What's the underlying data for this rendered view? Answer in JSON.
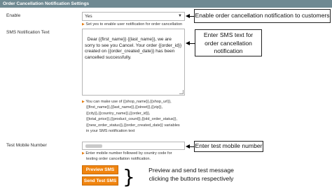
{
  "section": {
    "title": "Order Cancellation Notification Settings"
  },
  "enable": {
    "label": "Enable",
    "value": "Yes",
    "hint": "Set yes to enable user notification for order cancellation"
  },
  "sms_text": {
    "label": "SMS Notification Text",
    "value": "Dear {{first_name}} {{last_name}}, we are sorry to see you Cancel. Your order {{order_id}} created on {{order_created_date}} has been cancelled successfully.",
    "hint_lines": [
      "You can make use of {{shop_name}},{{shop_url}},",
      "{{first_name}},{{last_name}},{{street}},{{zip}},",
      "{{city}},{{country_name}},{{order_id}},",
      "{{total_price}},{{product_count}},{{old_order_status}},",
      "{{new_order_status}},{{order_created_date}} variables",
      "in your SMS notification text"
    ]
  },
  "test_mobile": {
    "label": "Test Mobile Number",
    "hint_lines": [
      "Enter mobile number followed by country code for",
      "testing order cancellation notification."
    ]
  },
  "buttons": {
    "preview": "Preview SMS",
    "send": "Send Test SMS"
  },
  "callouts": {
    "enable": "Enable order cancellation notification to customers",
    "sms": [
      "Enter SMS text for",
      "order cancellation",
      "notification"
    ],
    "mobile": "Enter test mobile number",
    "buttons": [
      "Preview and send test message",
      "clicking the buttons respectively"
    ]
  },
  "icons": {
    "select_arrow": "chevron-down-icon",
    "hint_marker": "triangle-right-icon"
  }
}
